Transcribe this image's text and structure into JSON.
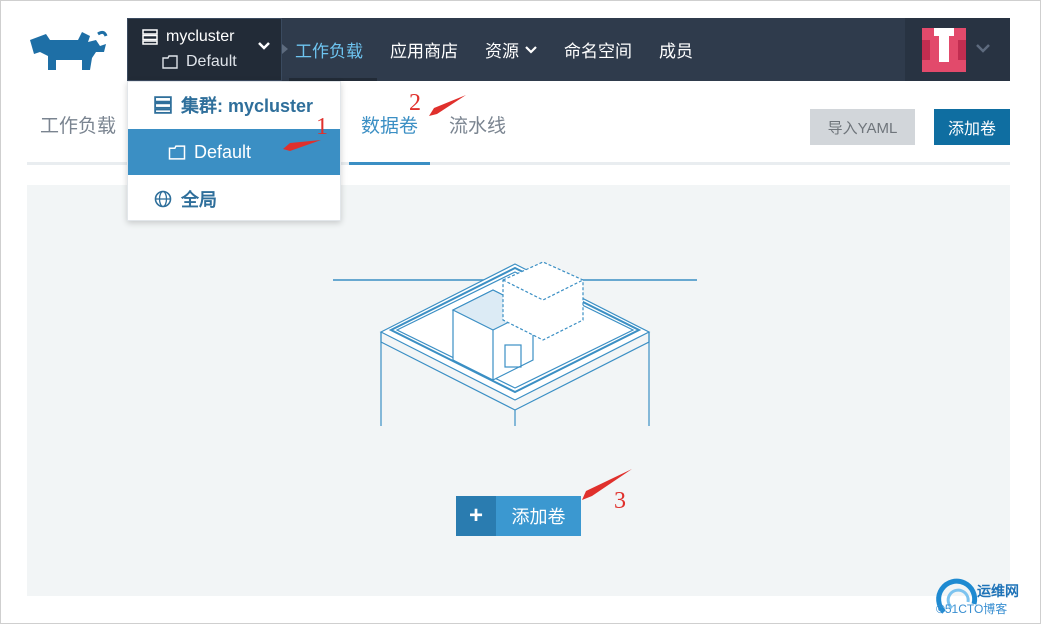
{
  "colors": {
    "topbar": "#2f3b4c",
    "accent": "#3b8fc4",
    "primary_button": "#0f6ea1",
    "annotation": "#e0302c"
  },
  "cluster_select": {
    "cluster_name": "mycluster",
    "project_name": "Default",
    "icons": [
      "server-icon",
      "folder-icon",
      "chevron-down-icon"
    ]
  },
  "nav": {
    "items": [
      {
        "label": "工作负载",
        "active": true
      },
      {
        "label": "应用商店"
      },
      {
        "label": "资源",
        "has_dropdown": true
      },
      {
        "label": "命名空间"
      },
      {
        "label": "成员"
      }
    ]
  },
  "subtabs": {
    "items": [
      {
        "label": "工作负载"
      },
      {
        "label": "数据卷",
        "active": true
      },
      {
        "label": "流水线"
      }
    ],
    "import_button": "导入YAML",
    "add_button": "添加卷"
  },
  "dropdown": {
    "cluster_label": "集群: mycluster",
    "project_label": "Default",
    "global_label": "全局"
  },
  "empty_state": {
    "add_button": "添加卷",
    "plus_icon": "+"
  },
  "annotations": [
    "1",
    "2",
    "3"
  ],
  "watermark": {
    "line1": "运维网",
    "line2": "©51CTO博客"
  }
}
